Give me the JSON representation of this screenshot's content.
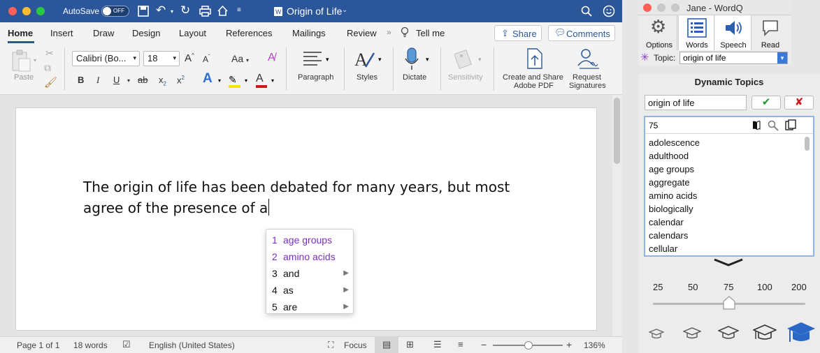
{
  "word": {
    "autosave_label": "AutoSave",
    "autosave_state": "OFF",
    "doc_title": "Origin of Life",
    "tabs": [
      "Home",
      "Insert",
      "Draw",
      "Design",
      "Layout",
      "References",
      "Mailings",
      "Review"
    ],
    "tell_me": "Tell me",
    "share_label": "Share",
    "comments_label": "Comments",
    "ribbon": {
      "paste": "Paste",
      "font_name": "Calibri (Bo...",
      "font_size": "18",
      "paragraph": "Paragraph",
      "styles": "Styles",
      "dictate": "Dictate",
      "sensitivity": "Sensitivity",
      "create_share_1": "Create and Share",
      "create_share_2": "Adobe PDF",
      "request_1": "Request",
      "request_2": "Signatures",
      "bold": "B",
      "italic": "I",
      "underline": "U",
      "strike": "ab",
      "subscript": "x",
      "superscript": "x",
      "grow": "A",
      "aa": "Aa"
    },
    "document_text_line1": "The origin of life has been debated for many years, but most",
    "document_text_line2": "agree of the presence of a",
    "status": {
      "page": "Page 1 of 1",
      "words": "18 words",
      "language": "English (United States)",
      "focus": "Focus",
      "zoom": "136%",
      "minus": "−",
      "plus": "+"
    }
  },
  "predictions": [
    {
      "num": "1",
      "text": "age groups",
      "color": "#7b2fbf",
      "submenu": false
    },
    {
      "num": "2",
      "text": "amino acids",
      "color": "#7b2fbf",
      "submenu": false
    },
    {
      "num": "3",
      "text": "and",
      "color": "#111111",
      "submenu": true
    },
    {
      "num": "4",
      "text": "as",
      "color": "#111111",
      "submenu": true
    },
    {
      "num": "5",
      "text": "are",
      "color": "#111111",
      "submenu": true
    }
  ],
  "wordq": {
    "title": "Jane - WordQ",
    "tools": [
      "Options",
      "Words",
      "Speech",
      "Read"
    ],
    "topic_label": "Topic:",
    "topic_value": "origin of life",
    "dynamic_topics": "Dynamic Topics",
    "topic_input": "origin of life",
    "ok_glyph": "✔",
    "cancel_glyph": "✘",
    "count": "75",
    "words": [
      "adolescence",
      "adulthood",
      "age groups",
      "aggregate",
      "amino acids",
      "biologically",
      "calendar",
      "calendars",
      "cellular"
    ],
    "slider_ticks": [
      "25",
      "50",
      "75",
      "100",
      "200"
    ],
    "slider_value": 75
  },
  "colors": {
    "word_blue": "#2b579a",
    "purple": "#7b2fbf",
    "green": "#1e9a2c",
    "red": "#d01818"
  }
}
